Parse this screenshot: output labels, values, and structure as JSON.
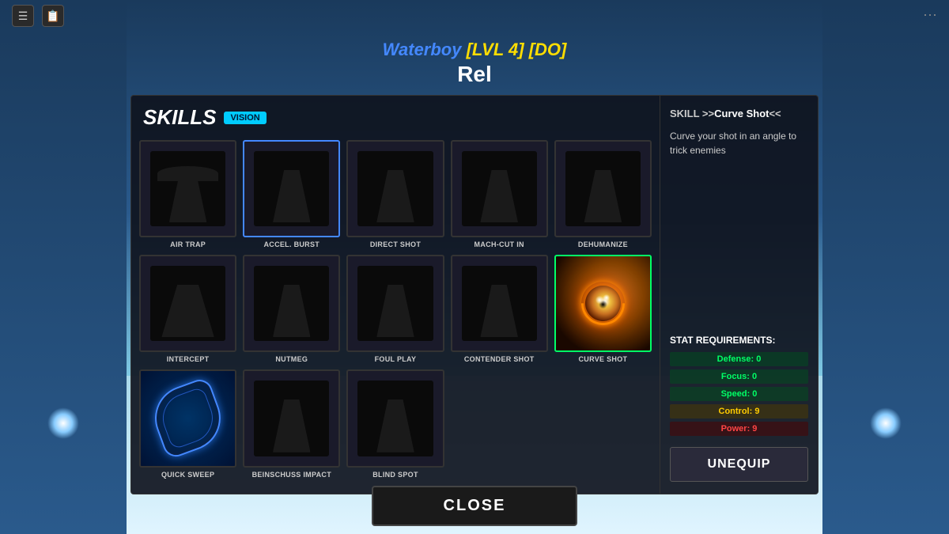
{
  "topbar": {
    "icon1": "☰",
    "icon2": "📋",
    "more_icon": "···"
  },
  "header": {
    "player_name": "Waterboy",
    "level": "[LVL 4]",
    "tag": "[DO]",
    "char_name": "Rel"
  },
  "skills_panel": {
    "title": "SKILLS",
    "vision_badge": "VISION",
    "skills": [
      {
        "id": "air-trap",
        "label": "AIR TRAP",
        "type": "shadow",
        "selected": false,
        "active": false
      },
      {
        "id": "accel-burst",
        "label": "ACCEL. BURST",
        "type": "shadow",
        "selected": false,
        "active": true
      },
      {
        "id": "direct-shot",
        "label": "DIRECT SHOT",
        "type": "shadow",
        "selected": false,
        "active": false
      },
      {
        "id": "mach-cut-in",
        "label": "MACH-CUT IN",
        "type": "shadow",
        "selected": false,
        "active": false
      },
      {
        "id": "dehumanize",
        "label": "DEHUMANIZE",
        "type": "shadow",
        "selected": false,
        "active": false
      },
      {
        "id": "intercept",
        "label": "INTERCEPT",
        "type": "shadow",
        "selected": false,
        "active": false
      },
      {
        "id": "nutmeg",
        "label": "NUTMEG",
        "type": "shadow",
        "selected": false,
        "active": false
      },
      {
        "id": "foul-play",
        "label": "FOUL PLAY",
        "type": "shadow",
        "selected": false,
        "active": false
      },
      {
        "id": "contender-shot",
        "label": "CONTENDER SHOT",
        "type": "shadow",
        "selected": false,
        "active": false
      },
      {
        "id": "curve-shot",
        "label": "CURVE SHOT",
        "type": "curve",
        "selected": true,
        "active": false
      },
      {
        "id": "quick-sweep",
        "label": "QUICK SWEEP",
        "type": "blue-swirl",
        "selected": false,
        "active": false
      },
      {
        "id": "beinschuss-impact",
        "label": "BEINSCHUSS IMPACT",
        "type": "shadow",
        "selected": false,
        "active": false
      },
      {
        "id": "blind-spot",
        "label": "BLIND SPOT",
        "type": "shadow",
        "selected": false,
        "active": false
      }
    ]
  },
  "info_panel": {
    "skill_label_prefix": "SKILL >>",
    "skill_label_name": "Curve Shot",
    "skill_label_suffix": "<<",
    "description": "Curve your shot in an angle to trick enemies",
    "stat_req_title": "STAT REQUIREMENTS:",
    "stats": [
      {
        "label": "Defense: 0",
        "color": "green"
      },
      {
        "label": "Focus: 0",
        "color": "green"
      },
      {
        "label": "Speed: 0",
        "color": "green"
      },
      {
        "label": "Control: 9",
        "color": "yellow"
      },
      {
        "label": "Power: 9",
        "color": "red"
      }
    ],
    "unequip_label": "UNEQUIP"
  },
  "close_button": {
    "label": "CLOSE"
  }
}
